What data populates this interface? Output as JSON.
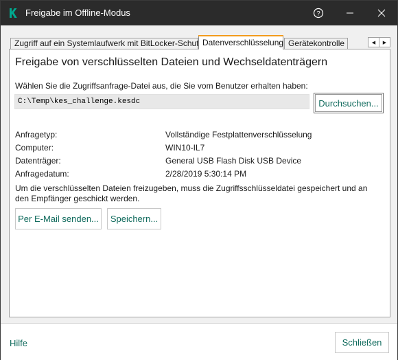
{
  "window": {
    "title": "Freigabe im Offline-Modus",
    "controls": {
      "help_glyph": "?",
      "minimize_icon": "minimize-icon",
      "close_icon": "close-icon"
    }
  },
  "tabs": [
    {
      "label": "Zugriff auf ein Systemlaufwerk mit BitLocker-Schutz",
      "active": false
    },
    {
      "label": "Datenverschlüsselung",
      "active": true
    },
    {
      "label": "Gerätekontrolle",
      "active": false
    }
  ],
  "tab_scroll": {
    "left": "◀",
    "right": "▶"
  },
  "main": {
    "heading": "Freigabe von verschlüsselten Dateien und Wechseldatenträgern",
    "instruction": "Wählen Sie die Zugriffsanfrage-Datei aus, die Sie vom Benutzer erhalten haben:",
    "file_path": "C:\\Temp\\kes_challenge.kesdc",
    "browse_label": "Durchsuchen...",
    "info": [
      {
        "label": "Anfragetyp:",
        "value": "Vollständige Festplattenverschlüsselung"
      },
      {
        "label": "Computer:",
        "value": "WIN10-IL7"
      },
      {
        "label": "Datenträger:",
        "value": "General USB Flash Disk USB Device"
      },
      {
        "label": "Anfragedatum:",
        "value": "2/28/2019 5:30:14 PM"
      }
    ],
    "note": "Um die verschlüsselten Dateien freizugeben, muss die Zugriffsschlüsseldatei gespeichert und an den Empfänger geschickt werden.",
    "email_label": "Per E-Mail senden...",
    "save_label": "Speichern..."
  },
  "footer": {
    "help_label": "Hilfe",
    "close_label": "Schließen"
  },
  "colors": {
    "titlebar": "#2b2b2b",
    "accent_tab": "#f29b1d",
    "link_green": "#0f6a5c",
    "logo_green": "#00a88e"
  }
}
